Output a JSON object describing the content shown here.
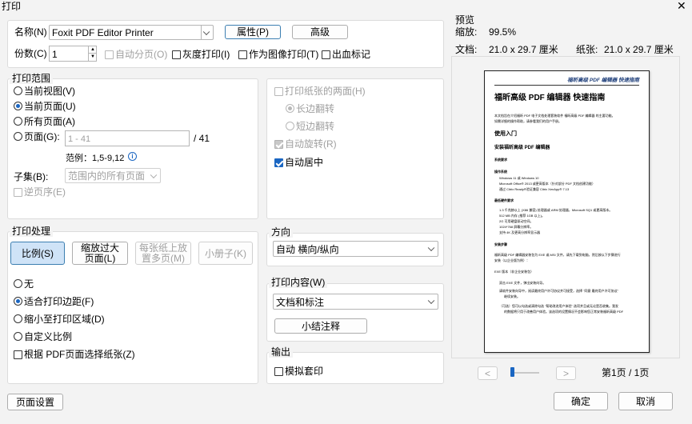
{
  "window": {
    "title": "打印"
  },
  "printer": {
    "name_label": "名称(N)",
    "name_value": "Foxit PDF Editor Printer",
    "properties_button": "属性(P)",
    "advanced_button": "高级"
  },
  "copies": {
    "label": "份数(C)",
    "value": "1",
    "collate_label": "自动分页(O)",
    "grayscale_label": "灰度打印(I)",
    "as_image_label": "作为图像打印(T)",
    "bleed_label": "出血标记"
  },
  "range": {
    "title": "打印范围",
    "current_view": "当前视图(V)",
    "current_page": "当前页面(U)",
    "all_pages": "所有页面(A)",
    "pages_label": "页面(G):",
    "pages_placeholder": "1 - 41",
    "pages_total": "/ 41",
    "example": "范例：1,5-9,12",
    "subset_label": "子集(B):",
    "subset_value": "范围内的所有页面",
    "reverse_label": "逆页序(E)"
  },
  "duplex": {
    "both_sides": "打印纸张的两面(H)",
    "flip_long": "长边翻转",
    "flip_short": "短边翻转",
    "auto_rotate": "自动旋转(R)",
    "auto_center": "自动居中"
  },
  "handling": {
    "title": "打印处理",
    "tab_scale": "比例(S)",
    "tab_tile_line1": "缩放过大",
    "tab_tile_line2": "页面(L)",
    "tab_multi_line1": "每张纸上放",
    "tab_multi_line2": "置多页(M)",
    "tab_booklet": "小册子(K)",
    "none": "无",
    "fit_margins": "适合打印边距(F)",
    "shrink": "缩小至打印区域(D)",
    "custom": "自定义比例",
    "choose_paper": "根据 PDF页面选择纸张(Z)"
  },
  "orientation": {
    "title": "方向",
    "value": "自动 横向/纵向"
  },
  "content": {
    "title": "打印内容(W)",
    "value": "文档和标注",
    "summarize_button": "小结注释"
  },
  "output": {
    "title": "输出",
    "simulate_overprint": "模拟套印"
  },
  "preview": {
    "title": "预览",
    "zoom_label": "缩放:",
    "zoom_value": "99.5%",
    "doc_label": "文档:",
    "doc_size": "21.0 x 29.7 厘米",
    "paper_label": "纸张:",
    "paper_size": "21.0 x 29.7 厘米",
    "page_info": "第1页 / 1页",
    "prev": "<",
    "next": ">",
    "doc": {
      "header": "福昕高级 PDF 编辑器 快速指南",
      "h1": "福昕高级 PDF 编辑器 快速指南",
      "intro": "本文档旨在介绍福昕 PDF 电子文档处理套装软件 福昕高级 PDF 编辑器 的主要功能。",
      "intro2": "如需详细的操作帮助，请参看我们的用户手册。",
      "s1": "使用入门",
      "s2": "安装福昕高级 PDF 编辑器",
      "s3": "系统要求",
      "s4": "操作系统",
      "os1": "Windows 11 或 Windows 10",
      "os2": "Microsoft Office® 2013 或更高版本（针对部分 PDF 文档创建功能）",
      "os3": "通过 Citrix Ready®验证兼容 Citrix XenApp® 7.13",
      "s5": "最低硬件要求",
      "hw1": "1.3 千兆赫以上 (X86 兼容) 处理器或 ARM 处理器，Microsoft SQ1 或更高版本。",
      "hw2": "512 MB 内存 (推荐 1GB 以上)。",
      "hw3": "2G 可用硬盘驱动空间。",
      "hw4": "1024*768 屏幕分辨率。",
      "hw5": "支持 4K 及更高分辨率显示器",
      "s6": "安装步骤",
      "st1": "福昕高级 PDF 编辑器安装包为 EXE 或 MSI 文件，请先下载到电脑，然后按以下步骤进行",
      "st1b": "安装（以企业版为例）：",
      "st2": "EXE 版本（非企业安装包）",
      "n1": "双击 EXE 文件，弹出安装向导。",
      "n2": "请软件安装向导中，阅读最终用户许可协议并可接受，选择 \"同意 最终用户许可协议\"",
      "n2b": "继续安装。",
      "n3": "（可选）您可以勾选或清除勾选 \"帮助改进用户体验\" 选项并且或无论是否收集。我发",
      "n3b": "的数据将只用于改善用户体验。该选项的设置情况不会影响您正常安装福昕高级 PDF"
    }
  },
  "footer": {
    "page_setup": "页面设置",
    "ok": "确定",
    "cancel": "取消"
  },
  "colors": {
    "accent": "#1a66c2",
    "background": "#f3f3f3",
    "link": "#1a66c2"
  }
}
